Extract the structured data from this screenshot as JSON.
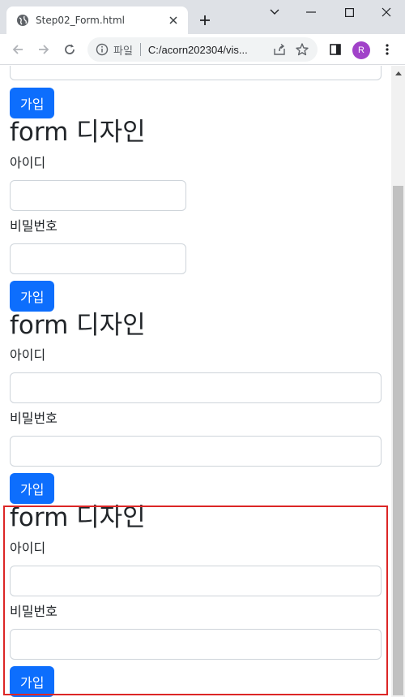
{
  "browser": {
    "tab_title": "Step02_Form.html",
    "omnibox_scheme": "파일",
    "omnibox_url": "C:/acorn202304/vis...",
    "avatar_initial": "R"
  },
  "forms": [
    {
      "heading": "",
      "id_label": "",
      "pw_label": "",
      "submit_label": "가입"
    },
    {
      "heading": "form 디자인",
      "id_label": "아이디",
      "pw_label": "비밀번호",
      "submit_label": "가입"
    },
    {
      "heading": "form 디자인",
      "id_label": "아이디",
      "pw_label": "비밀번호",
      "submit_label": "가입"
    },
    {
      "heading": "form 디자인",
      "id_label": "아이디",
      "pw_label": "비밀번호",
      "submit_label": "가입"
    }
  ],
  "colors": {
    "primary": "#0d6efd",
    "highlight_border": "#dc2626"
  }
}
